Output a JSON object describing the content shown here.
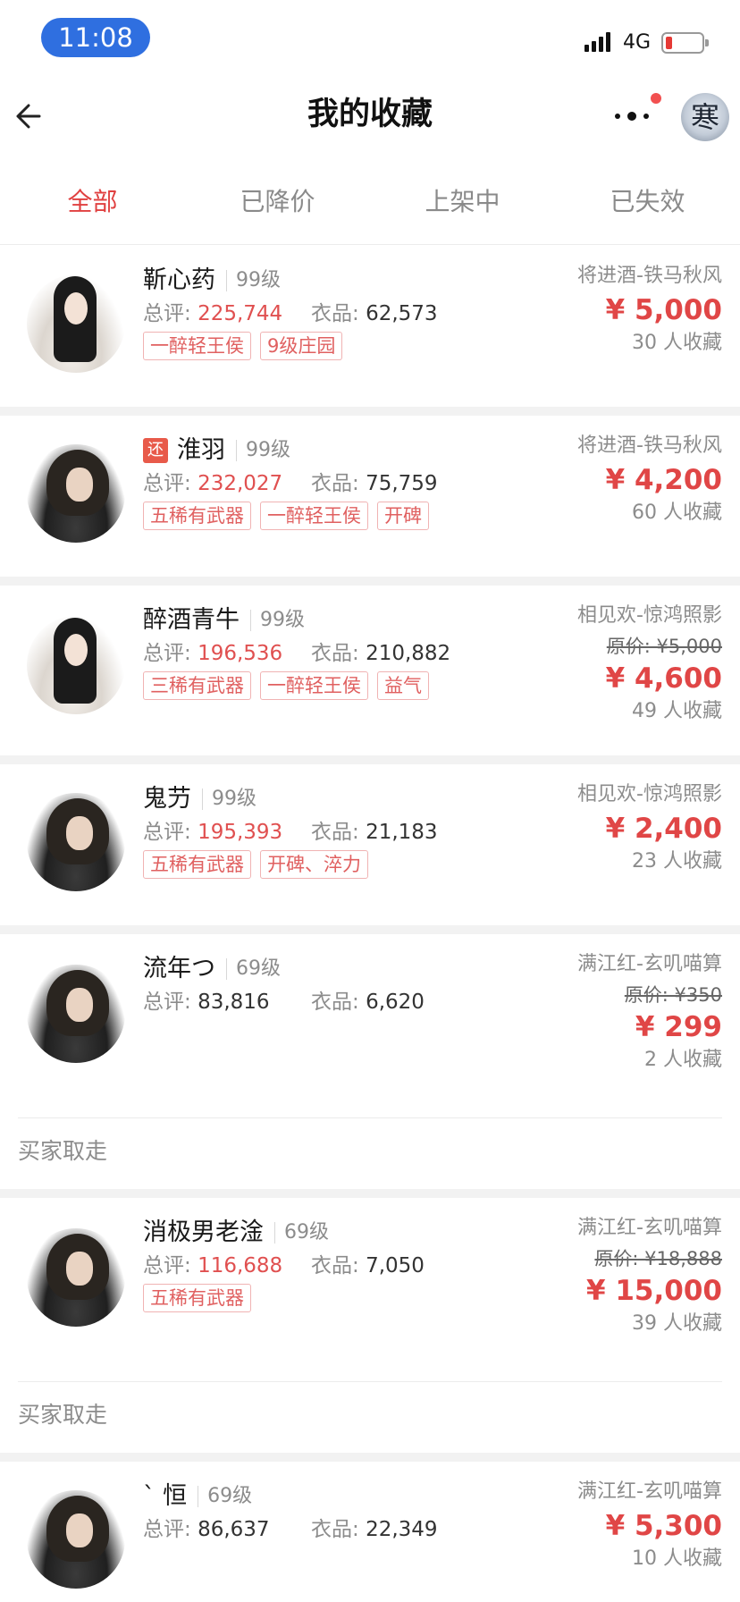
{
  "status": {
    "time": "11:08",
    "network": "4G"
  },
  "nav": {
    "title": "我的收藏"
  },
  "tabs": [
    "全部",
    "已降价",
    "上架中",
    "已失效"
  ],
  "items": [
    {
      "name": "靳心药",
      "level": "99级",
      "score_label": "总评:",
      "score": "225,744",
      "score_red": true,
      "cloth_label": "衣品:",
      "cloth": "62,573",
      "tags": [
        "一醉轻王侯",
        "9级庄园"
      ],
      "server": "将进酒-铁马秋风",
      "original_price": "",
      "price": "¥ 5,000",
      "favs": "30 人收藏",
      "avatar": "female-avatar"
    },
    {
      "name": "淮羽",
      "badge": "还",
      "level": "99级",
      "score_label": "总评:",
      "score": "232,027",
      "score_red": true,
      "cloth_label": "衣品:",
      "cloth": "75,759",
      "tags": [
        "五稀有武器",
        "一醉轻王侯",
        "开碑"
      ],
      "server": "将进酒-铁马秋风",
      "original_price": "",
      "price": "¥ 4,200",
      "favs": "60 人收藏",
      "avatar": "male-avatar"
    },
    {
      "name": "醉酒青牛",
      "level": "99级",
      "score_label": "总评:",
      "score": "196,536",
      "score_red": true,
      "cloth_label": "衣品:",
      "cloth": "210,882",
      "tags": [
        "三稀有武器",
        "一醉轻王侯",
        "益气"
      ],
      "server": "相见欢-惊鸿照影",
      "original_price": "原价: ¥5,000",
      "price": "¥ 4,600",
      "favs": "49 人收藏",
      "avatar": "female-avatar"
    },
    {
      "name": "鬼芀",
      "level": "99级",
      "score_label": "总评:",
      "score": "195,393",
      "score_red": true,
      "cloth_label": "衣品:",
      "cloth": "21,183",
      "tags": [
        "五稀有武器",
        "开碑、淬力"
      ],
      "server": "相见欢-惊鸿照影",
      "original_price": "",
      "price": "¥ 2,400",
      "favs": "23 人收藏",
      "avatar": "male-avatar"
    },
    {
      "name": "流年つ",
      "level": "69级",
      "score_label": "总评:",
      "score": "83,816",
      "score_red": false,
      "cloth_label": "衣品:",
      "cloth": "6,620",
      "tags": [],
      "server": "满江红-玄叽喵算",
      "original_price": "原价: ¥350",
      "price": "¥ 299",
      "favs": "2 人收藏",
      "avatar": "male-avatar",
      "taken": "买家取走"
    },
    {
      "name": "消极男老淦",
      "level": "69级",
      "score_label": "总评:",
      "score": "116,688",
      "score_red": true,
      "cloth_label": "衣品:",
      "cloth": "7,050",
      "tags": [
        "五稀有武器"
      ],
      "server": "满江红-玄叽喵算",
      "original_price": "原价: ¥18,888",
      "price": "¥ 15,000",
      "favs": "39 人收藏",
      "avatar": "male-avatar",
      "taken": "买家取走"
    },
    {
      "name": "ˋ 恒",
      "level": "69级",
      "score_label": "总评:",
      "score": "86,637",
      "score_red": false,
      "cloth_label": "衣品:",
      "cloth": "22,349",
      "tags": [],
      "server": "满江红-玄叽喵算",
      "original_price": "",
      "price": "¥ 5,300",
      "favs": "10 人收藏",
      "avatar": "male-avatar"
    }
  ],
  "colors": {
    "accent": "#e04646",
    "tag_border": "#f0b3b3",
    "time_pill": "#2f6fe0"
  },
  "icons": {
    "back": "back-arrow-icon",
    "more": "more-dots-icon"
  }
}
